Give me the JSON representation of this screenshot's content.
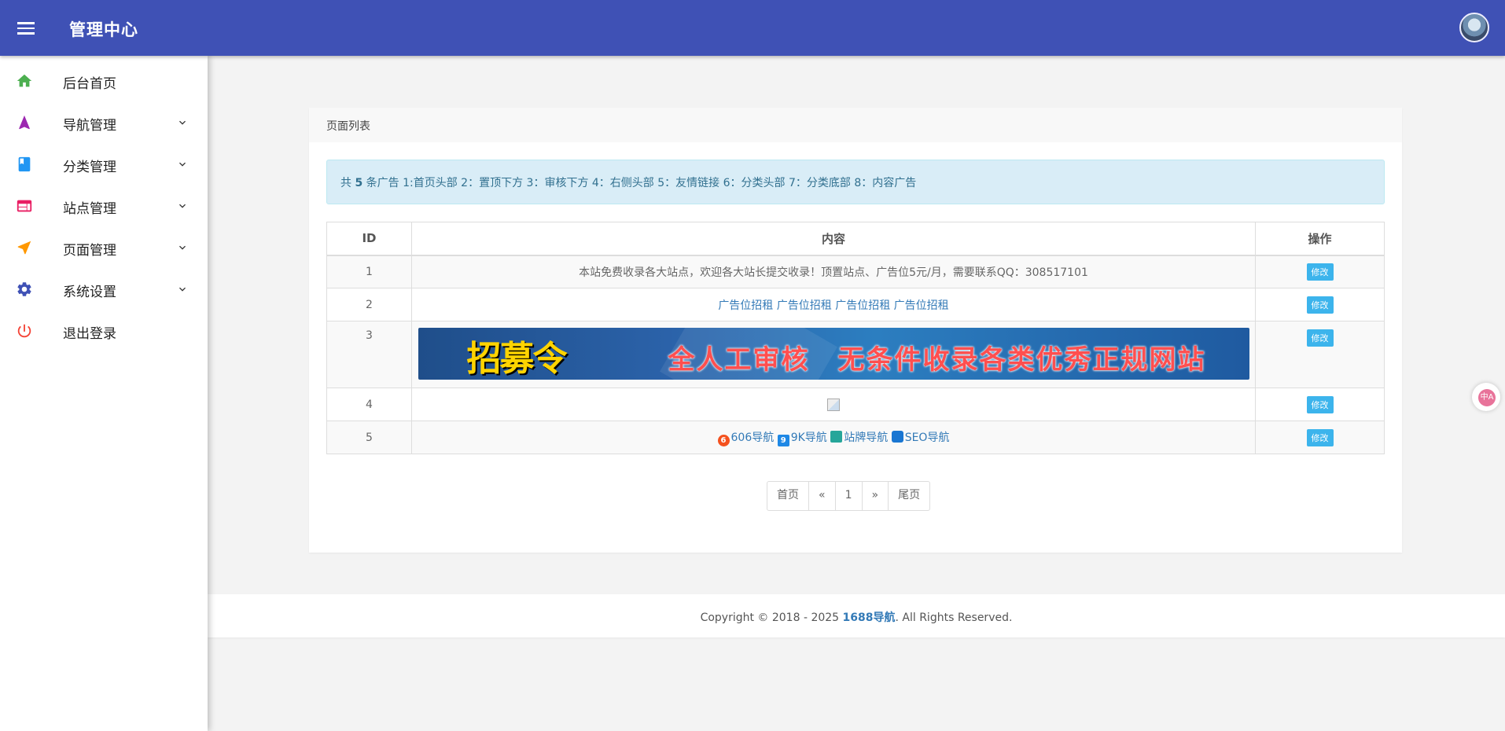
{
  "header": {
    "title": "管理中心"
  },
  "sidebar": {
    "items": [
      {
        "label": "后台首页",
        "icon": "home-icon",
        "color": "#4caf50",
        "expandable": false
      },
      {
        "label": "导航管理",
        "icon": "navigation-icon",
        "color": "#9c27b0",
        "expandable": true
      },
      {
        "label": "分类管理",
        "icon": "book-icon",
        "color": "#2196f3",
        "expandable": true
      },
      {
        "label": "站点管理",
        "icon": "web-icon",
        "color": "#e91e63",
        "expandable": true
      },
      {
        "label": "页面管理",
        "icon": "send-icon",
        "color": "#ff9800",
        "expandable": true
      },
      {
        "label": "系统设置",
        "icon": "gear-icon",
        "color": "#3f51b5",
        "expandable": true
      },
      {
        "label": "退出登录",
        "icon": "power-icon",
        "color": "#f44336",
        "expandable": false
      }
    ]
  },
  "card": {
    "title": "页面列表"
  },
  "alert": {
    "prefix": "共",
    "count": "5",
    "text": "条广告 1:首页头部 2：置顶下方 3：审核下方 4：右侧头部 5：友情链接 6：分类头部 7：分类底部 8：内容广告"
  },
  "table": {
    "headers": {
      "id": "ID",
      "content": "内容",
      "action": "操作"
    },
    "edit_label": "修改",
    "rows": [
      {
        "id": "1",
        "content": "本站免费收录各大站点，欢迎各大站长提交收录！顶置站点、广告位5元/月，需要联系QQ：308517101"
      },
      {
        "id": "2",
        "content": "广告位招租 广告位招租 广告位招租 广告位招租"
      },
      {
        "id": "3",
        "banner_left": "招募令",
        "banner_right": "全人工审核　无条件收录各类优秀正规网站"
      },
      {
        "id": "4"
      },
      {
        "id": "5",
        "links": [
          "606导航",
          "9K导航",
          "站牌导航",
          "SEO导航"
        ]
      }
    ]
  },
  "pagination": {
    "first": "首页",
    "prev": "«",
    "current": "1",
    "next": "»",
    "last": "尾页"
  },
  "footer": {
    "before": "Copyright © 2018 - 2025 ",
    "brand": "1688导航",
    "after": ". All Rights Reserved."
  },
  "translate": {
    "label": "中A"
  }
}
